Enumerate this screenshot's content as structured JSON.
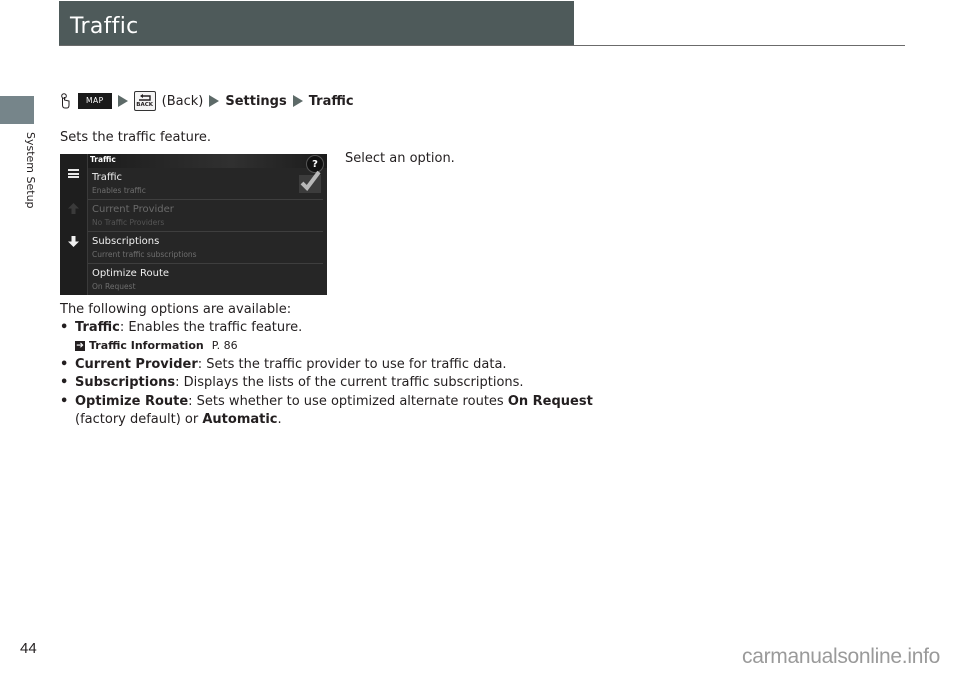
{
  "header": {
    "title": "Traffic"
  },
  "side_tab": {
    "label": "System Setup"
  },
  "breadcrumb": {
    "hand_icon": "hand-press-icon",
    "map_key": "MAP",
    "back_key": "BACK",
    "back_label": "(Back)",
    "settings": "Settings",
    "traffic": "Traffic",
    "arrow_icon": "right-triangle-icon"
  },
  "intro": "Sets the traffic feature.",
  "instruction": "Select an option.",
  "screen": {
    "title": "Traffic",
    "help": "?",
    "nav_icons": [
      "menu-icon",
      "up-arrow-icon",
      "down-arrow-icon"
    ],
    "rows": [
      {
        "title": "Traffic",
        "subtitle": "Enables traffic",
        "checked": true,
        "disabled": false
      },
      {
        "title": "Current Provider",
        "subtitle": "No Traffic Providers",
        "disabled": true
      },
      {
        "title": "Subscriptions",
        "subtitle": "Current traffic subscriptions",
        "disabled": false
      },
      {
        "title": "Optimize Route",
        "subtitle": "On Request",
        "disabled": false
      }
    ]
  },
  "options_heading": "The following options are available:",
  "options": [
    {
      "term": "Traffic",
      "desc": ": Enables the traffic feature."
    },
    {
      "term": "Current Provider",
      "desc": ": Sets the traffic provider to use for traffic data."
    },
    {
      "term": "Subscriptions",
      "desc": ": Displays the lists of the current traffic subscriptions."
    },
    {
      "term": "Optimize Route",
      "desc": ": Sets whether to use optimized alternate routes ",
      "bold2": "On Request",
      "desc2": "(factory default) or ",
      "bold3": "Automatic",
      "desc3": "."
    }
  ],
  "reference": {
    "label": "Traffic Information",
    "page": "P. 86",
    "icon": "reference-arrow-icon"
  },
  "footer": {
    "page_number": "44",
    "watermark": "carmanualsonline.info"
  }
}
